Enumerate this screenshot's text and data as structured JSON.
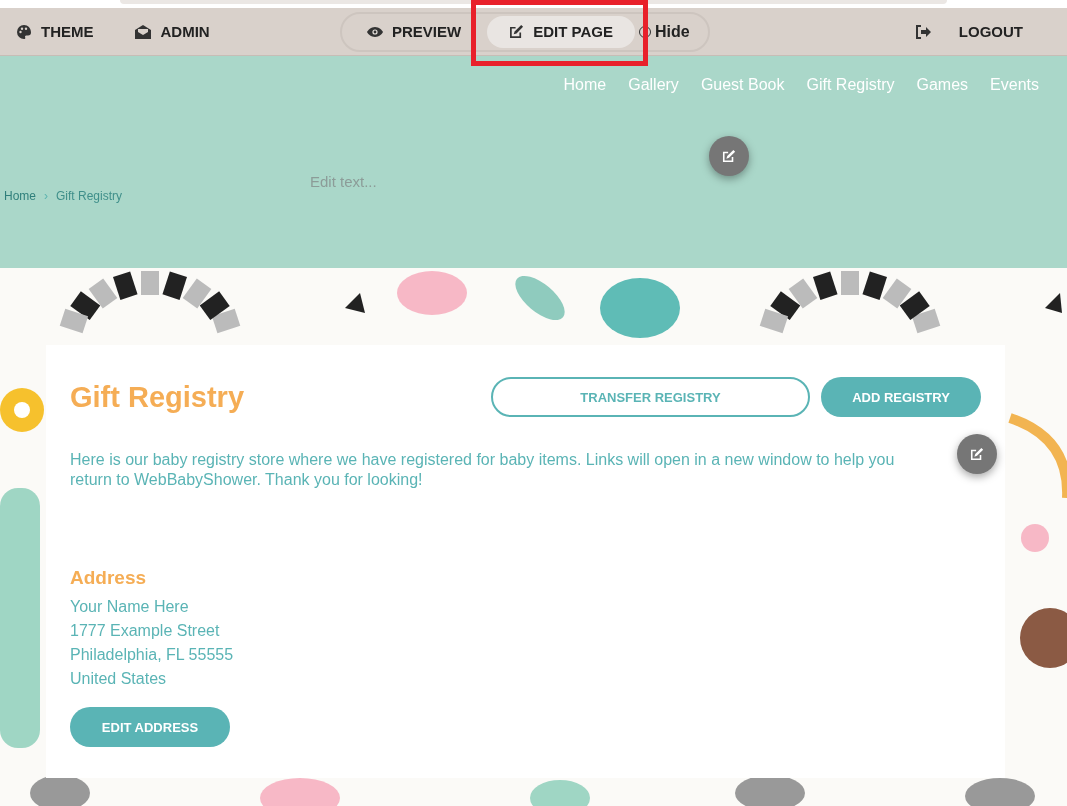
{
  "toolbar": {
    "left": [
      {
        "kind": "palette",
        "label": "THEME"
      },
      {
        "kind": "envelope",
        "label": "ADMIN"
      }
    ],
    "modes": [
      {
        "kind": "eye",
        "label": "PREVIEW",
        "selected": false
      },
      {
        "kind": "edit",
        "label": "EDIT PAGE",
        "selected": true
      }
    ],
    "hide_toggle": {
      "label": "Hide",
      "on": false
    },
    "logout": {
      "label": "LOGOUT"
    }
  },
  "nav": [
    {
      "label": "Home"
    },
    {
      "label": "Gallery"
    },
    {
      "label": "Guest Book"
    },
    {
      "label": "Gift Registry"
    },
    {
      "label": "Games"
    },
    {
      "label": "Events"
    }
  ],
  "breadcrumb": [
    {
      "kind": "link",
      "label": "Home",
      "selected": false
    },
    {
      "kind": "separator",
      "label": "›"
    },
    {
      "kind": "link",
      "label": "Gift Registry",
      "selected": true
    }
  ],
  "header_text": {
    "placeholder": "Edit text..."
  },
  "card": {
    "title": "Gift Registry",
    "buttons": [
      {
        "kind": "outline",
        "label": "TRANSFER REGISTRY"
      },
      {
        "kind": "filled",
        "label": "ADD REGISTRY"
      }
    ],
    "intro": "Here is our baby registry store where we have registered for baby items. Links will open in a new window to help you return to WebBabyShower. Thank you for looking!",
    "address_title": "Address",
    "address_lines": [
      "Your Name Here",
      "1777 Example Street",
      "Philadelphia, FL 55555",
      "United States"
    ],
    "edit_address": "EDIT ADDRESS"
  }
}
